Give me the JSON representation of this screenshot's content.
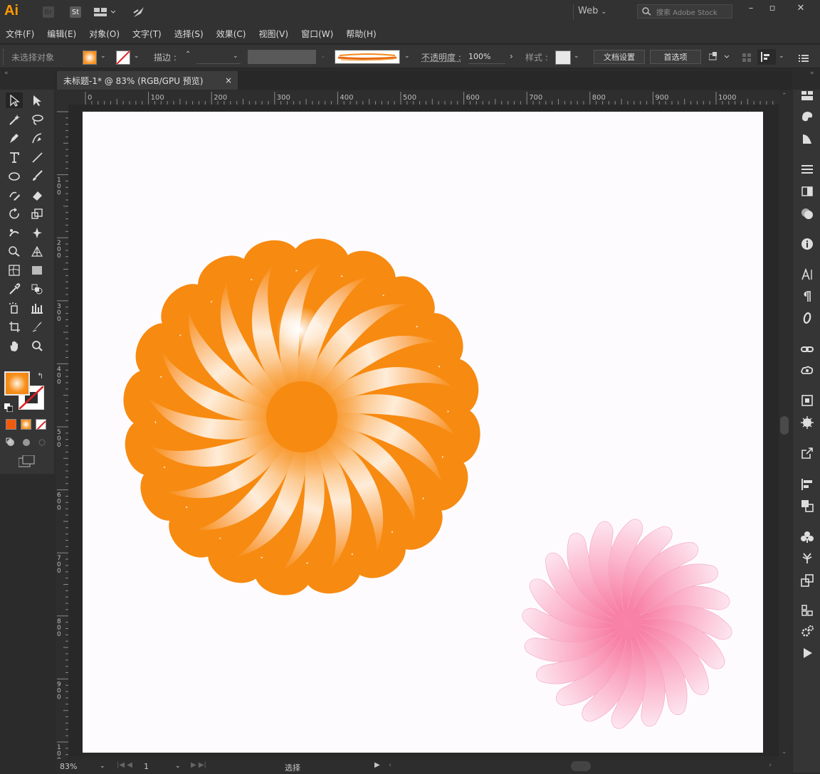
{
  "app": {
    "logo": "Ai",
    "bridge_label": "Br",
    "stock_label": "St",
    "workspace": "Web",
    "search_placeholder": "搜索 Adobe Stock"
  },
  "menu": [
    "文件(F)",
    "编辑(E)",
    "对象(O)",
    "文字(T)",
    "选择(S)",
    "效果(C)",
    "视图(V)",
    "窗口(W)",
    "帮助(H)"
  ],
  "control": {
    "selection_status": "未选择对象",
    "stroke_label": "描边 :",
    "opacity_label": "不透明度 :",
    "opacity_value": "100%",
    "style_label": "样式 :",
    "doc_setup_button": "文档设置",
    "preferences_button": "首选项"
  },
  "document": {
    "tab_title": "未标题-1* @ 83% (RGB/GPU 预览)",
    "close_symbol": "×"
  },
  "rulers": {
    "horizontal": [
      "0",
      "100",
      "200",
      "300",
      "400",
      "500",
      "600",
      "700",
      "800",
      "900",
      "1000"
    ],
    "vertical": [
      "100",
      "200",
      "300",
      "400",
      "500",
      "600",
      "700",
      "800",
      "900",
      "1000"
    ]
  },
  "status": {
    "zoom": "83%",
    "page": "1",
    "mode": "选择"
  },
  "colors": {
    "fill_swatch": "#f7901e",
    "orange_flower": "#f78a10",
    "pink_flower": "#f882a8",
    "brand": "#ff9a00"
  },
  "tools": [
    "selection-tool-icon",
    "direct-selection-tool-icon",
    "magic-wand-tool-icon",
    "lasso-tool-icon",
    "pen-tool-icon",
    "curvature-tool-icon",
    "type-tool-icon",
    "line-tool-icon",
    "ellipse-tool-icon",
    "paintbrush-tool-icon",
    "shaper-tool-icon",
    "eraser-tool-icon",
    "rotate-tool-icon",
    "scale-tool-icon",
    "warp-tool-icon",
    "puppet-warp-tool-icon",
    "shape-builder-tool-icon",
    "perspective-grid-tool-icon",
    "mesh-tool-icon",
    "gradient-tool-icon",
    "eyedropper-tool-icon",
    "blend-tool-icon",
    "symbol-sprayer-tool-icon",
    "column-graph-tool-icon",
    "artboard-tool-icon",
    "slice-tool-icon",
    "hand-tool-icon",
    "zoom-tool-icon"
  ],
  "panels": [
    "libraries-icon",
    "color-icon",
    "color-guide-icon",
    "stroke-icon",
    "gradient-icon",
    "transparency-icon",
    "info-icon",
    "character-icon",
    "paragraph-icon",
    "opentype-icon",
    "links-icon",
    "cc-libraries-icon",
    "asset-export-icon",
    "appearance-icon",
    "export-icon",
    "align-icon",
    "pathfinder-icon",
    "symbols-icon",
    "brushes-icon",
    "transform-icon",
    "layers-icon",
    "actions-gear-icon",
    "play-icon"
  ]
}
